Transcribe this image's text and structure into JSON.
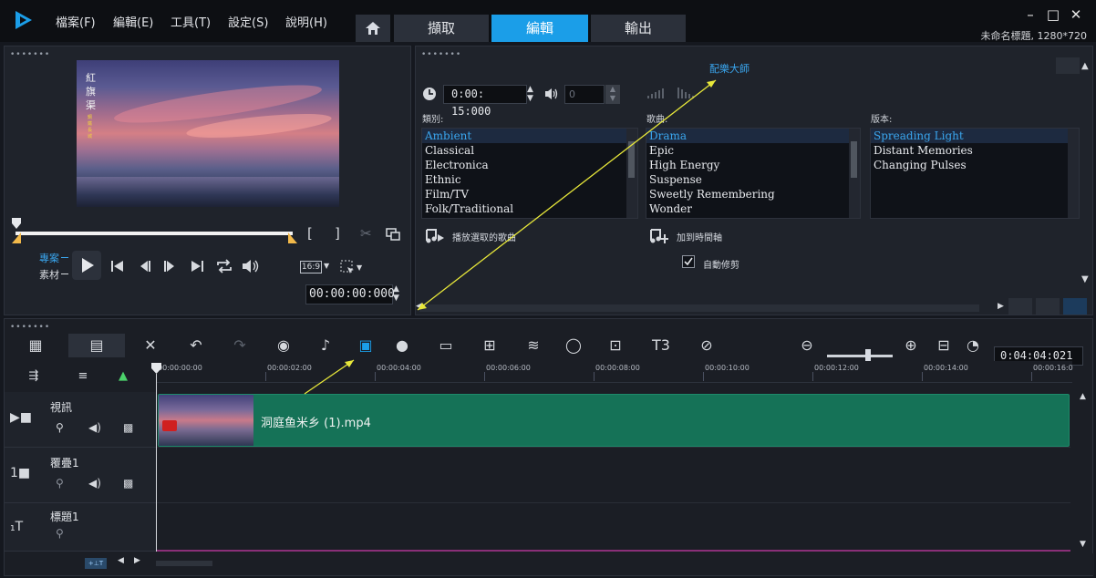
{
  "app": {
    "menus": [
      "檔案(F)",
      "編輯(E)",
      "工具(T)",
      "設定(S)",
      "說明(H)"
    ],
    "tabs": {
      "capture": "擷取",
      "edit": "編輯",
      "share": "輸出"
    },
    "project_info": "未命名標題, 1280*720",
    "accent": "#1b9ee8"
  },
  "player": {
    "preview_text": "紅旗渠",
    "preview_subtext": "鋼鐵長城",
    "mode_project": "專案",
    "mode_clip": "素材",
    "aspect": "16:9",
    "timecode": "00:00:00:000"
  },
  "library": {
    "title": "配樂大師",
    "duration": "0:00: 15:000",
    "volume": "0",
    "category_label": "類別:",
    "song_label": "歌曲:",
    "version_label": "版本:",
    "categories": [
      "Ambient",
      "Classical",
      "Electronica",
      "Ethnic",
      "Film/TV",
      "Folk/Traditional"
    ],
    "songs": [
      "Drama",
      "Epic",
      "High Energy",
      "Suspense",
      "Sweetly Remembering",
      "Wonder"
    ],
    "versions": [
      "Spreading Light",
      "Distant Memories",
      "Changing Pulses"
    ],
    "play_selected": "播放選取的歌曲",
    "add_to_timeline": "加到時間軸",
    "auto_trim": "自動修剪"
  },
  "timeline": {
    "duration": "0:04:04:021",
    "ruler": [
      "00:00:00:00",
      "00:00:02:00",
      "00:00:04:00",
      "00:00:06:00",
      "00:00:08:00",
      "00:00:10:00",
      "00:00:12:00",
      "00:00:14:00",
      "00:00:16:0"
    ],
    "tracks": {
      "video": "視訊",
      "overlay": "覆疊1",
      "title": "標題1"
    },
    "clip_name": "洞庭鱼米乡 (1).mp4",
    "clip_color": "#157257"
  }
}
